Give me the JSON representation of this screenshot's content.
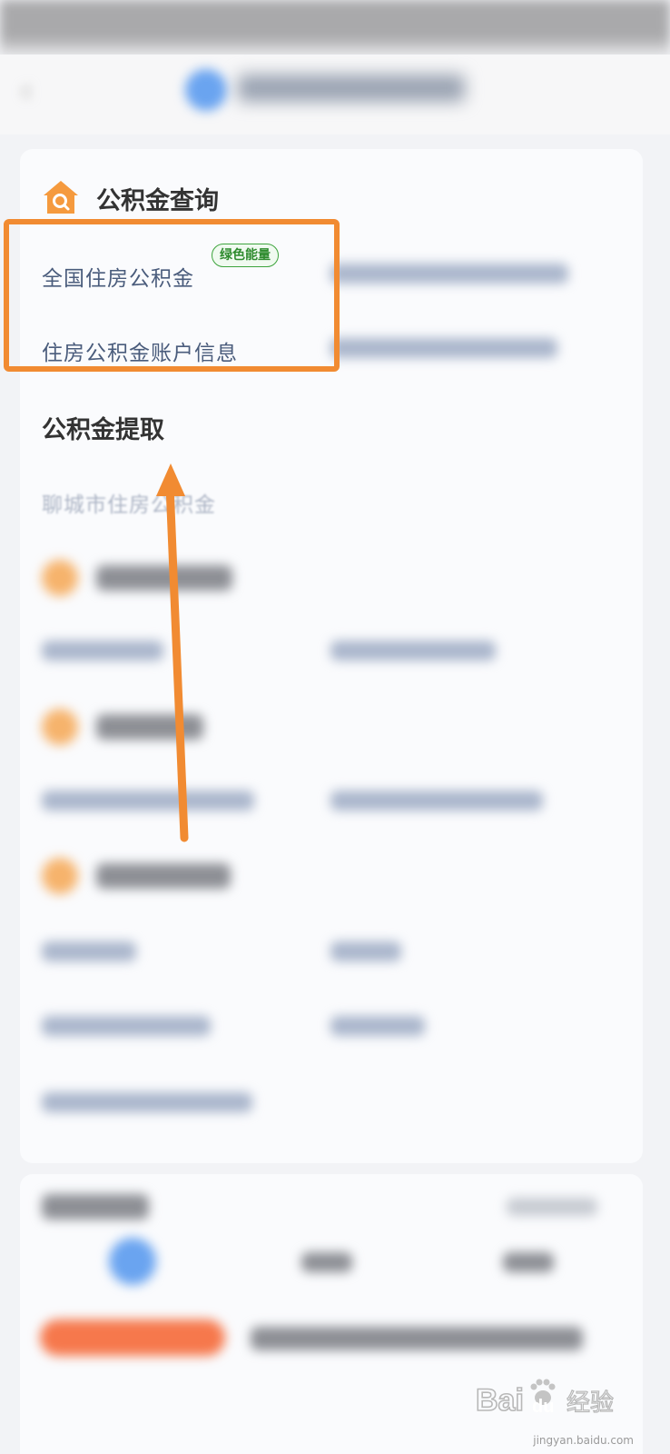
{
  "query_section": {
    "title": "公积金查询",
    "items": [
      {
        "label": "全国住房公积金",
        "badge": "绿色能量"
      },
      {
        "label": "住房公积金账户信息"
      }
    ]
  },
  "withdraw_section": {
    "title": "公积金提取",
    "items": [
      {
        "label": "聊城市住房公积金"
      }
    ]
  },
  "watermark": {
    "brand": "Bai",
    "paw": "du",
    "suffix": "经验",
    "url": "jingyan.baidu.com"
  },
  "colors": {
    "accent": "#f18b32",
    "link": "#4a5c7c",
    "badge_green": "#2e8b2e"
  }
}
